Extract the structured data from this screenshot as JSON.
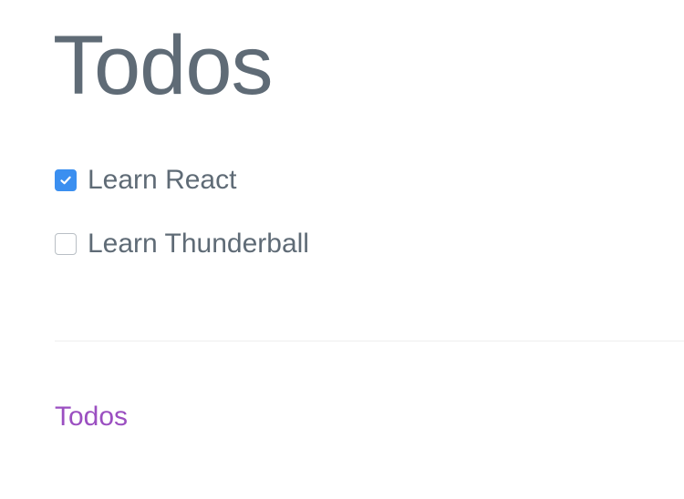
{
  "header": {
    "title": "Todos"
  },
  "todos": [
    {
      "label": "Learn React",
      "checked": true
    },
    {
      "label": "Learn Thunderball",
      "checked": false
    }
  ],
  "footer": {
    "link_label": "Todos"
  },
  "colors": {
    "text": "#5f6b76",
    "checkbox_checked": "#3b8ff0",
    "link": "#9b4fc1",
    "divider": "#eeeeee"
  },
  "icons": {
    "checked": "checkmark-icon"
  }
}
